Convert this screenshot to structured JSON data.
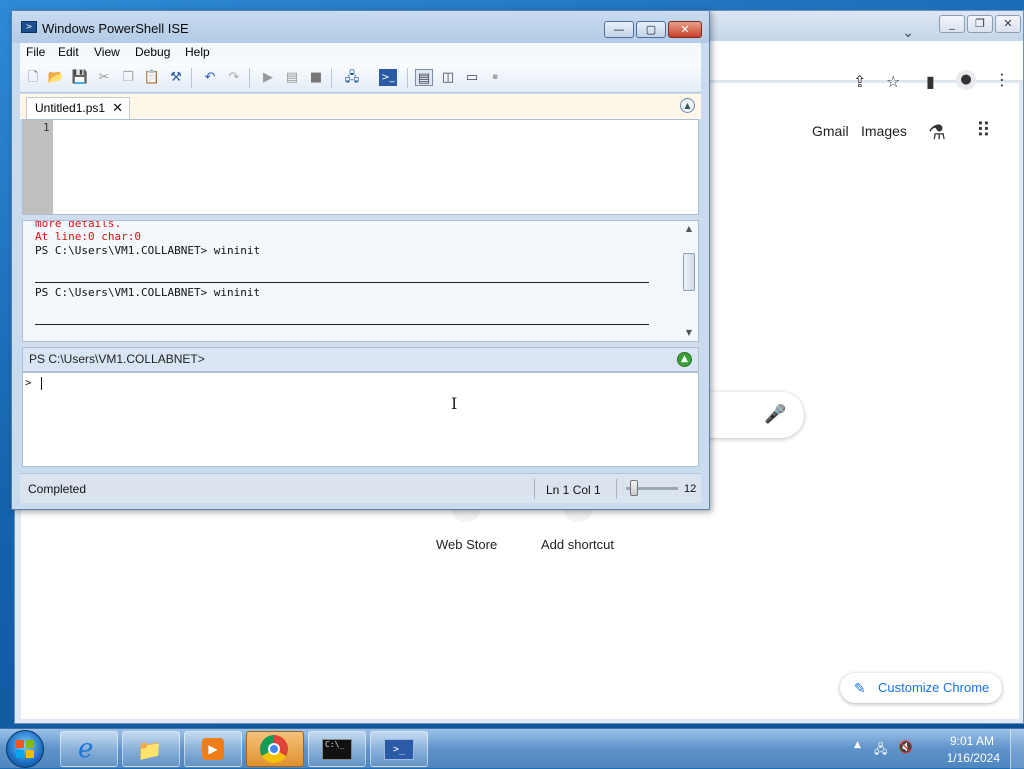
{
  "chrome": {
    "tabstrip_chevron": "⌄",
    "links": {
      "gmail": "Gmail",
      "images": "Images"
    },
    "shortcuts": [
      {
        "label": "Web Store"
      },
      {
        "label": "Add shortcut"
      }
    ],
    "customize_label": "Customize Chrome",
    "icons": {
      "share": "share-icon",
      "bookmark": "star-icon",
      "sidebar": "side-panel-icon",
      "profile": "profile-icon",
      "menu": "kebab-menu-icon",
      "labs": "flask-icon",
      "apps": "apps-grid-icon",
      "mic": "microphone-icon",
      "pencil": "pencil-icon"
    },
    "colors": {
      "link": "#202124",
      "accent": "#1a73e8"
    }
  },
  "ise": {
    "title": "Windows PowerShell ISE",
    "menu": [
      "File",
      "Edit",
      "View",
      "Debug",
      "Help"
    ],
    "tab": {
      "label": "Untitled1.ps1",
      "close": "✕"
    },
    "script": {
      "line_number": "1"
    },
    "output": {
      "lines": [
        {
          "text": "more details.",
          "type": "error"
        },
        {
          "text": "At line:0 char:0",
          "type": "error"
        },
        {
          "text": "PS C:\\Users\\VM1.COLLABNET> wininit",
          "type": "normal"
        },
        {
          "text": "PS C:\\Users\\VM1.COLLABNET> wininit",
          "type": "normal"
        }
      ]
    },
    "prompt": "PS C:\\Users\\VM1.COLLABNET>",
    "console_caret": ">",
    "status": {
      "text": "Completed",
      "position": "Ln 1  Col 1",
      "zoom": "12"
    },
    "colors": {
      "error": "#e01010",
      "title_bg": "#b3cbe6"
    }
  },
  "taskbar": {
    "apps": [
      {
        "name": "internet-explorer",
        "glyph": "e"
      },
      {
        "name": "file-explorer",
        "glyph": "📁"
      },
      {
        "name": "media-player",
        "glyph": "▶"
      },
      {
        "name": "chrome",
        "glyph": "◉"
      },
      {
        "name": "command-prompt",
        "glyph": "C:\\_"
      },
      {
        "name": "powershell",
        "glyph": ">_"
      }
    ],
    "clock": {
      "time": "9:01 AM",
      "date": "1/16/2024"
    }
  }
}
